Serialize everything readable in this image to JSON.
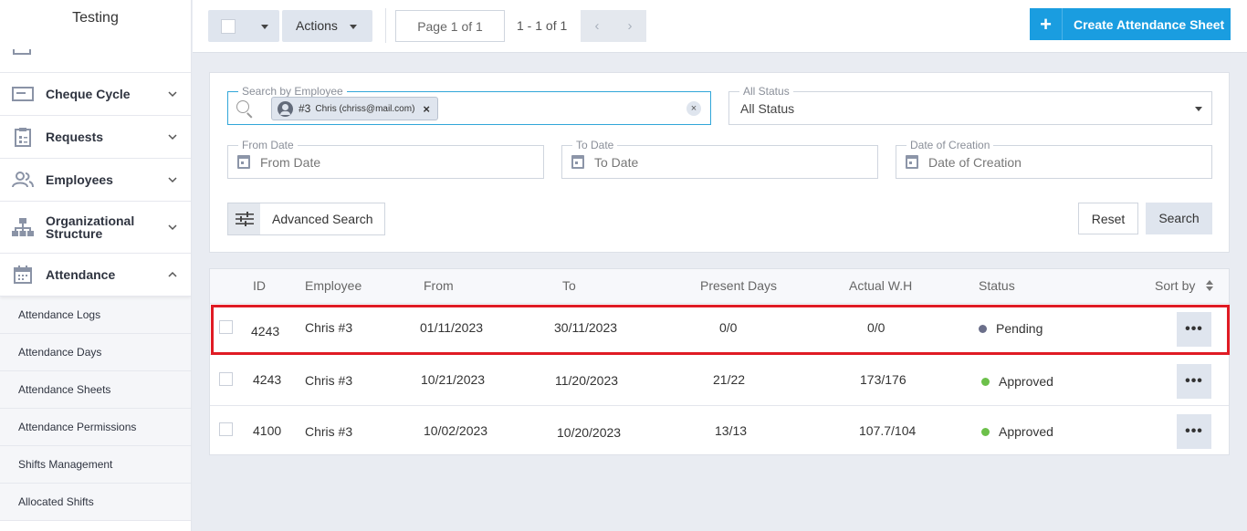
{
  "sidebar": {
    "title": "Testing",
    "items": [
      {
        "label": "Cheque Cycle",
        "icon": "cheque-icon"
      },
      {
        "label": "Requests",
        "icon": "clipboard-icon"
      },
      {
        "label": "Employees",
        "icon": "users-icon"
      },
      {
        "label_line1": "Organizational",
        "label_line2": "Structure",
        "icon": "org-chart-icon"
      },
      {
        "label": "Attendance",
        "icon": "calendar-icon"
      }
    ],
    "subitems": [
      "Attendance Logs",
      "Attendance Days",
      "Attendance Sheets",
      "Attendance Permissions",
      "Shifts Management",
      "Allocated Shifts"
    ]
  },
  "toolbar": {
    "actions_label": "Actions",
    "page_label": "Page 1 of 1",
    "count_label": "1 - 1 of 1",
    "create_label": "Create Attendance Sheet"
  },
  "filters": {
    "search_label": "Search by Employee",
    "chip_id": "#3",
    "chip_name": "Chris (chriss@mail.com)",
    "status_label": "All Status",
    "status_value": "All Status",
    "from_label": "From Date",
    "from_placeholder": "From Date",
    "to_label": "To Date",
    "to_placeholder": "To Date",
    "creation_label": "Date of Creation",
    "creation_placeholder": "Date of Creation",
    "advanced_label": "Advanced Search",
    "reset_label": "Reset",
    "search_button": "Search"
  },
  "table": {
    "headers": {
      "id": "ID",
      "employee": "Employee",
      "from": "From",
      "to": "To",
      "present": "Present Days",
      "actual": "Actual W.H",
      "status": "Status",
      "sort": "Sort by"
    },
    "rows": [
      {
        "id": "4243",
        "employee": "Chris #3",
        "from": "01/11/2023",
        "to": "30/11/2023",
        "present": "0/0",
        "actual": "0/0",
        "status": "Pending",
        "status_color": "#6b6f8a"
      },
      {
        "id": "4243",
        "employee": "Chris #3",
        "from": "10/21/2023",
        "to": "11/20/2023",
        "present": "21/22",
        "actual": "173/176",
        "status": "Approved",
        "status_color": "#6cc04a"
      },
      {
        "id": "4100",
        "employee": "Chris #3",
        "from": "10/02/2023",
        "to": "10/20/2023",
        "present": "13/13",
        "actual": "107.7/104",
        "status": "Approved",
        "status_color": "#6cc04a"
      }
    ]
  },
  "colors": {
    "accent": "#1a9de0",
    "highlight": "#e01b24"
  }
}
